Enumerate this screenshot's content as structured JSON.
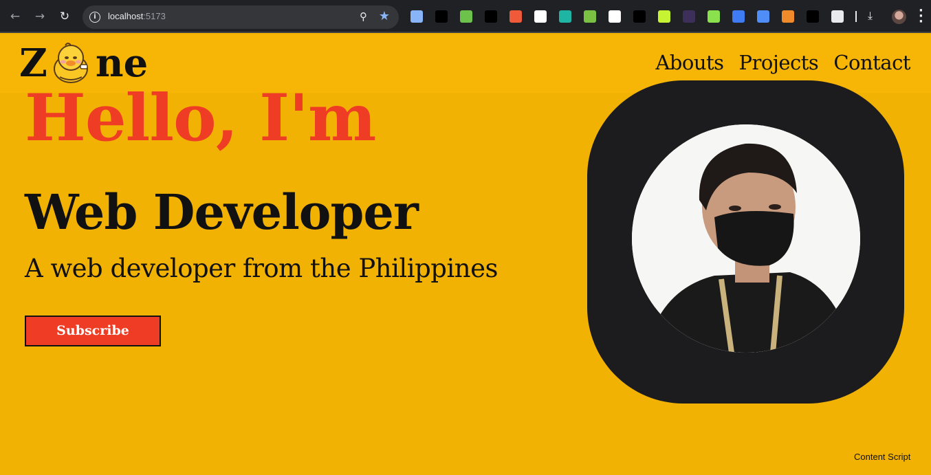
{
  "browser": {
    "url_host": "localhost",
    "url_port": ":5173",
    "extensions": [
      {
        "name": "docs-icon",
        "color": "#8ab4f8"
      },
      {
        "name": "a-icon",
        "color": "#000000"
      },
      {
        "name": "chart-icon",
        "color": "#6cc24a"
      },
      {
        "name": "wand-icon",
        "color": "#000000"
      },
      {
        "name": "wave-icon",
        "color": "#ee5a3a"
      },
      {
        "name": "graph-icon",
        "color": "#ffffff"
      },
      {
        "name": "bird-icon",
        "color": "#1fb5a5"
      },
      {
        "name": "hex-icon",
        "color": "#7ac143"
      },
      {
        "name": "grid-icon",
        "color": "#ffffff"
      },
      {
        "name": "dots-icon",
        "color": "#000000"
      },
      {
        "name": "seventy-seven-icon",
        "color": "#c6f432"
      },
      {
        "name": "spark-icon",
        "color": "#3c2f5a"
      },
      {
        "name": "cross-icon",
        "color": "#8be04e"
      },
      {
        "name": "xtools-icon",
        "color": "#3f7cf4"
      },
      {
        "name": "s-icon",
        "color": "#4f8ef7"
      },
      {
        "name": "orange-icon",
        "color": "#f08a2a"
      },
      {
        "name": "asterisk-icon",
        "color": "#000000"
      },
      {
        "name": "puzzle-icon",
        "color": "#e8eaed"
      }
    ]
  },
  "header": {
    "logo_z": "Z",
    "logo_ne": "ne",
    "nav": [
      "Abouts",
      "Projects",
      "Contact"
    ]
  },
  "hero": {
    "greeting": "Hello, I'm",
    "role": "Web Developer",
    "tagline": "A web developer from the Philippines",
    "cta": "Subscribe"
  },
  "overlay": {
    "content_script": "Content Script"
  },
  "colors": {
    "page_bg": "#f2b204",
    "header_bg": "#f7b506",
    "accent_red": "#ee3d24",
    "frame_dark": "#1c1c1e"
  }
}
